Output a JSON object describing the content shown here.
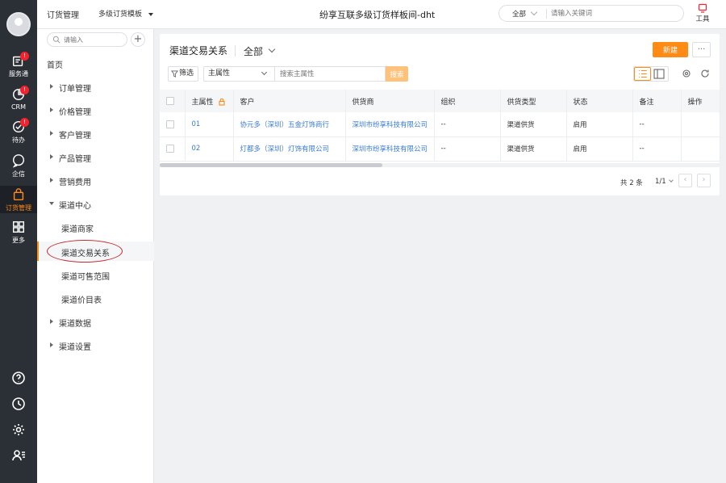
{
  "rail": {
    "items": [
      {
        "label": "服务通",
        "icon": "service-icon",
        "badge": "!"
      },
      {
        "label": "CRM",
        "icon": "crm-icon",
        "badge": "!"
      },
      {
        "label": "待办",
        "icon": "todo-icon",
        "badge": "!"
      },
      {
        "label": "企信",
        "icon": "chat-icon"
      },
      {
        "label": "订货管理",
        "icon": "shopping-bag-icon",
        "active": true
      },
      {
        "label": "更多",
        "icon": "grid-icon"
      }
    ],
    "bottom_icons": [
      "help-icon",
      "history-icon",
      "settings-icon",
      "contacts-icon"
    ]
  },
  "topbar": {
    "module": "订货管理",
    "template": "多级订货模板",
    "title": "纷享互联多级订货样板间-dht",
    "search_scope": "全部",
    "search_placeholder": "请输入关键词",
    "tools_label": "工具"
  },
  "nav": {
    "search_placeholder": "请输入",
    "home": "首页",
    "items": [
      {
        "label": "订单管理"
      },
      {
        "label": "价格管理"
      },
      {
        "label": "客户管理"
      },
      {
        "label": "产品管理"
      },
      {
        "label": "营销费用"
      },
      {
        "label": "渠道中心",
        "expanded": true
      }
    ],
    "sub_items": [
      {
        "label": "渠道商家"
      },
      {
        "label": "渠道交易关系",
        "active": true
      },
      {
        "label": "渠道可售范围"
      },
      {
        "label": "渠道价目表"
      }
    ],
    "after_items": [
      {
        "label": "渠道数据"
      },
      {
        "label": "渠道设置"
      }
    ]
  },
  "main": {
    "title": "渠道交易关系",
    "scope": "全部",
    "new_button": "新建",
    "more_button": "···",
    "filter_button": "筛选",
    "attr_select": "主属性",
    "search_placeholder": "搜索主属性",
    "search_button": "搜索",
    "columns": [
      "主属性",
      "客户",
      "供货商",
      "组织",
      "供货类型",
      "状态",
      "备注",
      "操作"
    ],
    "rows": [
      {
        "id": "01",
        "customer": "协元多（深圳）五金灯饰商行",
        "supplier": "深圳市纷享科技有限公司",
        "org": "--",
        "supply_type": "渠道供货",
        "status": "启用",
        "note": "--",
        "action": ""
      },
      {
        "id": "02",
        "customer": "灯都多（深圳）灯饰有限公司",
        "supplier": "深圳市纷享科技有限公司",
        "org": "--",
        "supply_type": "渠道供货",
        "status": "启用",
        "note": "--",
        "action": ""
      }
    ],
    "pager": {
      "total": "共 2 条",
      "page": "1/1",
      "prev": "‹",
      "next": "›"
    }
  },
  "colors": {
    "accent": "#ff8b14",
    "link": "#3a7bd5",
    "rail_bg": "#2b2f36",
    "badge": "#f5222d"
  }
}
